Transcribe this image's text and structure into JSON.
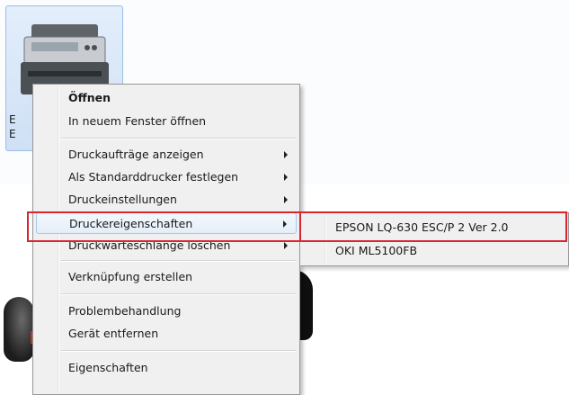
{
  "background": {
    "device_tile_label_line1": "E",
    "device_tile_label_line2": "E"
  },
  "context_menu": {
    "items": [
      {
        "label": "Öffnen",
        "bold": true
      },
      {
        "label": "In neuem Fenster öffnen"
      },
      {
        "label": "Druckaufträge anzeigen",
        "submenu": true
      },
      {
        "label": "Als Standarddrucker festlegen",
        "submenu": true
      },
      {
        "label": "Druckeinstellungen",
        "submenu": true
      },
      {
        "label": "Druckereigenschaften",
        "submenu": true,
        "active": true
      },
      {
        "label": "Druckwarteschlange löschen",
        "submenu": true
      },
      {
        "label": "Verknüpfung erstellen"
      },
      {
        "label": "Problembehandlung"
      },
      {
        "label": "Gerät entfernen"
      },
      {
        "label": "Eigenschaften"
      }
    ]
  },
  "submenu": {
    "items": [
      {
        "label": "EPSON LQ-630 ESC/P 2 Ver 2.0"
      },
      {
        "label": "OKI ML5100FB"
      }
    ]
  },
  "colors": {
    "highlight_red": "#d9262f",
    "menu_bg": "#f0f0f0",
    "hover_blue": "#a8c8ec"
  }
}
